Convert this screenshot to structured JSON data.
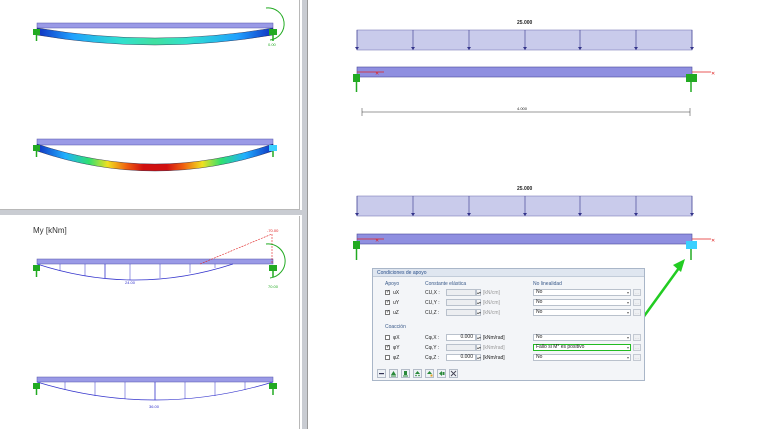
{
  "left_top": {
    "diagram1": {
      "end_label": "0.00"
    },
    "diagram2": {}
  },
  "left_bottom": {
    "moment_title": "My [kNm]",
    "diagram1": {
      "peak_label": "24.00",
      "end_label": "-70.00",
      "support_label": "70.00"
    },
    "diagram2": {
      "peak_label": "36.00"
    }
  },
  "right": {
    "load_top": {
      "value": "25.000"
    },
    "beam_top": {
      "length_label": "4.000"
    },
    "load_bottom": {
      "value": "25.000"
    }
  },
  "dialog": {
    "title": "Condiciones de apoyo",
    "col_support": "Apoyo",
    "col_elastic": "Constante elástica",
    "col_nonlinear": "No linealidad",
    "supports": [
      {
        "name": "uX",
        "checked": "✓",
        "const_label": "CU,X :",
        "value": "",
        "unit": "[kN/cm]",
        "nonlinear": "No"
      },
      {
        "name": "uY",
        "checked": "✓",
        "const_label": "CU,Y :",
        "value": "",
        "unit": "[kN/cm]",
        "nonlinear": "No"
      },
      {
        "name": "uZ",
        "checked": "✓",
        "const_label": "CU,Z :",
        "value": "",
        "unit": "[kN/cm]",
        "nonlinear": "No"
      }
    ],
    "section_restraint": "Coacción",
    "restraints": [
      {
        "name": "φX",
        "checked": "",
        "const_label": "Cφ,X :",
        "value": "0.000",
        "unit": "[kNm/rad]",
        "nonlinear": "No"
      },
      {
        "name": "φY",
        "checked": "✓",
        "const_label": "Cφ,Y :",
        "value": "",
        "unit": "[kNm/rad]",
        "nonlinear": "Fallo si M* es positivo"
      },
      {
        "name": "φZ",
        "checked": "",
        "const_label": "Cφ,Z :",
        "value": "0.000",
        "unit": "[kNm/rad]",
        "nonlinear": "No"
      }
    ],
    "spin_symbol": "▴▾",
    "dropdown_symbol": "▾",
    "edit_symbol": "…"
  },
  "colors": {
    "beam": "#8f8fe0",
    "load": "#c9cbeb",
    "support": "#22aa22",
    "support_light": "#3ad0ff",
    "axis_red": "#e02020",
    "moment_line": "#3333cc",
    "highlight_arrow": "#22cc22"
  }
}
